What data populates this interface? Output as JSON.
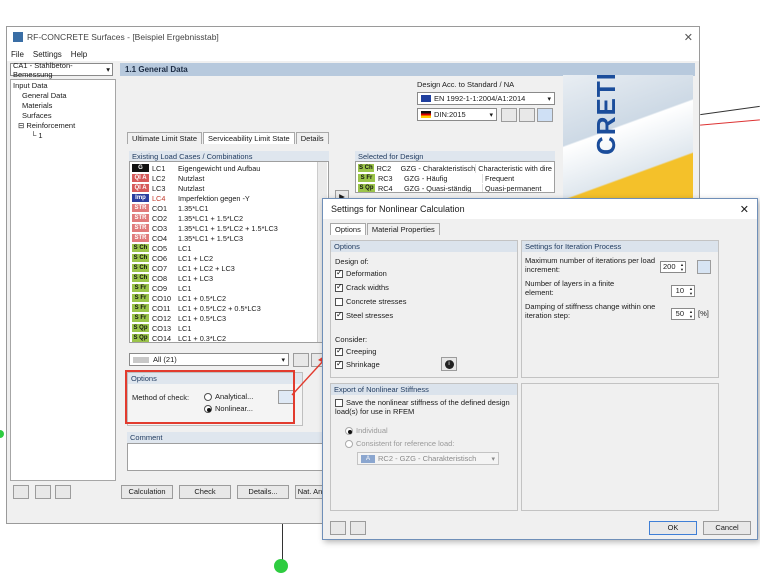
{
  "main_window": {
    "title": "RF-CONCRETE Surfaces - [Beispiel Ergebnisstab]",
    "menu": [
      "File",
      "Settings",
      "Help"
    ],
    "case_selector": "CA1 - Stahlbeton-Bemessung",
    "section_title": "1.1 General Data",
    "nav_tree": [
      "Input Data",
      "General Data",
      "Materials",
      "Surfaces",
      "Reinforcement",
      "1"
    ],
    "design_standard_label": "Design Acc. to Standard / NA",
    "standard_value": "EN 1992-1-1:2004/A1:2014",
    "na_value": "DIN:2015",
    "tabs": [
      "Ultimate Limit State",
      "Serviceability Limit State",
      "Details"
    ],
    "existing_header": "Existing Load Cases / Combinations",
    "load_cases": [
      {
        "badge": "G",
        "id": "LC1",
        "desc": "Eigengewicht und Aufbau"
      },
      {
        "badge": "QI A",
        "id": "LC2",
        "desc": "Nutzlast"
      },
      {
        "badge": "QI A",
        "id": "LC3",
        "desc": "Nutzlast"
      },
      {
        "badge": "Imp",
        "id": "LC4",
        "desc": "Imperfektion gegen -Y"
      },
      {
        "badge": "STR",
        "id": "CO1",
        "desc": "1.35*LC1"
      },
      {
        "badge": "STR",
        "id": "CO2",
        "desc": "1.35*LC1 + 1.5*LC2"
      },
      {
        "badge": "STR",
        "id": "CO3",
        "desc": "1.35*LC1 + 1.5*LC2 + 1.5*LC3"
      },
      {
        "badge": "STR",
        "id": "CO4",
        "desc": "1.35*LC1 + 1.5*LC3"
      },
      {
        "badge": "S Ch",
        "id": "CO5",
        "desc": "LC1"
      },
      {
        "badge": "S Ch",
        "id": "CO6",
        "desc": "LC1 + LC2"
      },
      {
        "badge": "S Ch",
        "id": "CO7",
        "desc": "LC1 + LC2 + LC3"
      },
      {
        "badge": "S Ch",
        "id": "CO8",
        "desc": "LC1 + LC3"
      },
      {
        "badge": "S Fr",
        "id": "CO9",
        "desc": "LC1"
      },
      {
        "badge": "S Fr",
        "id": "CO10",
        "desc": "LC1 + 0.5*LC2"
      },
      {
        "badge": "S Fr",
        "id": "CO11",
        "desc": "LC1 + 0.5*LC2 + 0.5*LC3"
      },
      {
        "badge": "S Fr",
        "id": "CO12",
        "desc": "LC1 + 0.5*LC3"
      },
      {
        "badge": "S Qp",
        "id": "CO13",
        "desc": "LC1"
      },
      {
        "badge": "S Qp",
        "id": "CO14",
        "desc": "LC1 + 0.3*LC2"
      }
    ],
    "filter_value": "All (21)",
    "selected_header": "Selected for Design",
    "selected": [
      {
        "badge": "S Ch",
        "id": "RC2",
        "desc": "GZG - Charakteristisch",
        "type": "Characteristic with dire"
      },
      {
        "badge": "S Fr",
        "id": "RC3",
        "desc": "GZG - Häufig",
        "type": "Frequent"
      },
      {
        "badge": "S Qp",
        "id": "RC4",
        "desc": "GZG - Quasi-ständig",
        "type": "Quasi-permanent"
      }
    ],
    "options_header": "Options",
    "method_label": "Method of check:",
    "method_analytical": "Analytical...",
    "method_nonlinear": "Nonlinear...",
    "comment_label": "Comment",
    "bottom_buttons": [
      "Calculation",
      "Check",
      "Details...",
      "Nat. An"
    ]
  },
  "dialog": {
    "title": "Settings for Nonlinear Calculation",
    "tabs": [
      "Options",
      "Material Properties"
    ],
    "options_header": "Options",
    "design_of": "Design of:",
    "design_items": [
      {
        "label": "Deformation",
        "checked": true
      },
      {
        "label": "Crack widths",
        "checked": true
      },
      {
        "label": "Concrete stresses",
        "checked": false
      },
      {
        "label": "Steel stresses",
        "checked": true
      }
    ],
    "consider": "Consider:",
    "consider_items": [
      {
        "label": "Creeping",
        "checked": true
      },
      {
        "label": "Shrinkage",
        "checked": true
      }
    ],
    "iteration_header": "Settings for Iteration Process",
    "max_iter_label": "Maximum number of iterations per load increment:",
    "max_iter_value": "200",
    "layers_label": "Number of layers in a finite element:",
    "layers_value": "10",
    "damping_label": "Damping of stiffness change within one iteration step:",
    "damping_value": "50",
    "damping_unit": "[%]",
    "export_header": "Export of Nonlinear Stiffness",
    "export_label": "Save the nonlinear stiffness of the defined design load(s) for use in RFEM",
    "individual": "Individual",
    "consistent": "Consistent for reference load:",
    "ref_load_badge": "A",
    "ref_load": "RC2 - GZG - Charakteristisch",
    "ok": "OK",
    "cancel": "Cancel"
  },
  "colors": {
    "highlight": "#e23b2e",
    "header_blue": "#b7c9dd",
    "accent": "#1b4d9b"
  }
}
